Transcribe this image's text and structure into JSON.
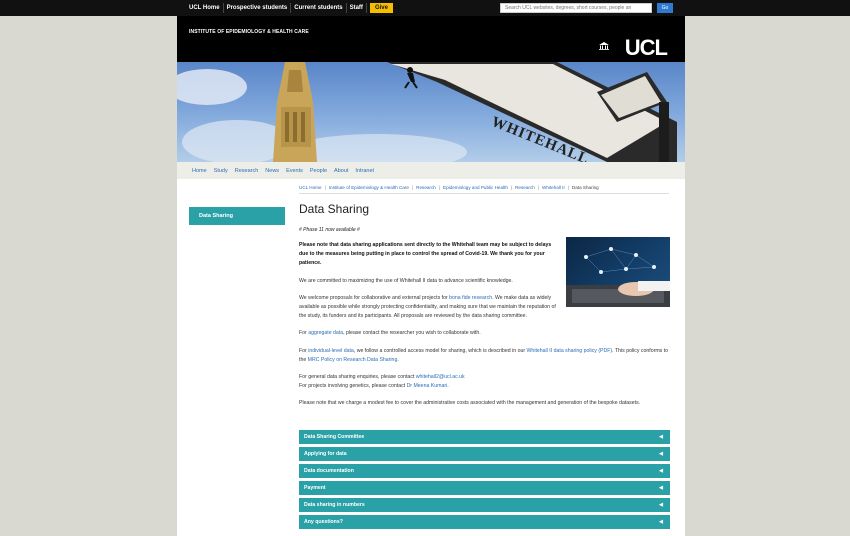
{
  "topbar": {
    "links": [
      "UCL Home",
      "Prospective students",
      "Current students",
      "Staff"
    ],
    "give": "Give",
    "search_placeholder": "Search UCL websites, degrees, short courses, people an",
    "search_button": "Go"
  },
  "header": {
    "department": "INSTITUTE OF EPIDEMIOLOGY & HEALTH CARE",
    "logo": "UCL",
    "banner_sign_text": "WHITEHALL"
  },
  "mainnav": [
    "Home",
    "Study",
    "Research",
    "News",
    "Events",
    "People",
    "About",
    "Intranet"
  ],
  "breadcrumb": [
    "UCL Home",
    "Institute of Epidemiology & Health Care",
    "Research",
    "Epidemiology and Public Health",
    "Research",
    "Whitehall II",
    "Data Sharing"
  ],
  "sidebar": {
    "items": [
      {
        "label": "Data Sharing"
      }
    ]
  },
  "main": {
    "title": "Data Sharing",
    "phase_note": "# Phase 11 now available #",
    "covid_note": "Please note that data sharing applications sent directly to the Whitehall team may be subject to delays due to the measures being putting in place to control the spread of Covid-19. We thank you for your patience.",
    "commit": "We are committed to maximizing the use of Whitehall II data to advance scientific knowledge.",
    "welcome_pre": "We welcome proposals for collaborative and external projects for ",
    "welcome_link": "bona fide research",
    "welcome_post": ". We make data as widely available as possible while strongly protecting confidentiality, and making sure that we maintain the reputation of the study, its funders and its participants.  All proposals are reviewed by the data sharing committee.",
    "agg_pre": "For ",
    "agg_link": "aggregate data",
    "agg_post": ", please contact the researcher you wish to collaborate with.",
    "ind_pre": "For ",
    "ind_link": "individual-level data",
    "ind_mid": ", we follow a controlled access model for sharing, which is described in our ",
    "ind_link2": "Whitehall II data sharing policy (PDF)",
    "ind_mid2": ". This policy conforms to the ",
    "ind_link3": "MRC Policy on Research Data Sharing",
    "ind_post": ".",
    "enq_pre": "For general data sharing enquiries, please contact ",
    "enq_link": "whitehall2@ucl.ac.uk",
    "gen_pre": "For projects involving genetics, please contact ",
    "gen_link": "Dr Meena Kumari",
    "gen_post": ".",
    "fee": "Please note that we charge a modest fee to cover the administrative costs associated with the management and generation of the bespoke datasets."
  },
  "accordion": [
    "Data Sharing Committee",
    "Applying for data",
    "Data documentation",
    "Payment",
    "Data sharing in numbers",
    "Any questions?"
  ],
  "colors": {
    "teal": "#2aa1a6",
    "link": "#2a6db5",
    "give": "#f6be00"
  }
}
